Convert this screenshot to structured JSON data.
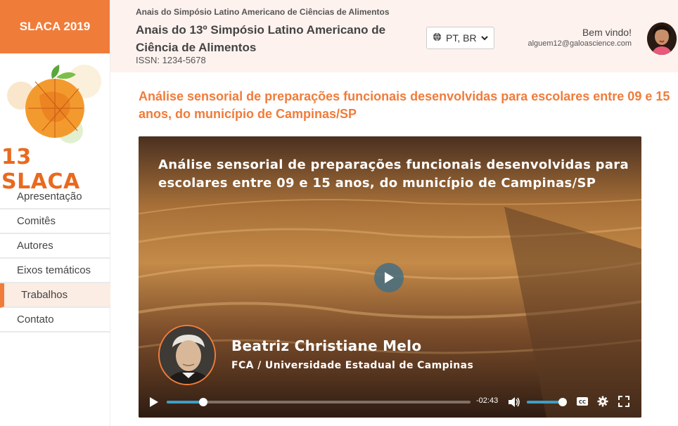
{
  "sidebar": {
    "brand": "SLACA 2019",
    "logo_text": "13 SLACA",
    "items": [
      {
        "label": "Apresentação",
        "active": false
      },
      {
        "label": "Comitês",
        "active": false
      },
      {
        "label": "Autores",
        "active": false
      },
      {
        "label": "Eixos temáticos",
        "active": false
      },
      {
        "label": "Trabalhos",
        "active": true
      },
      {
        "label": "Contato",
        "active": false
      }
    ]
  },
  "header": {
    "small_title": "Anais do Simpósio Latino Americano de Ciências de Alimentos",
    "title": "Anais do 13º Simpósio Latino Americano de Ciência de Alimentos",
    "issn": "ISSN: 1234-5678",
    "language": "PT, BR",
    "welcome": "Bem vindo!",
    "email": "alguem12@galoascience.com"
  },
  "main": {
    "article_title": "Análise sensorial de preparações funcionais desenvolvidas para escolares entre 09 e 15 anos, do município de Campinas/SP"
  },
  "video": {
    "title": "Análise sensorial de preparações funcionais desenvolvidas para escolares entre 09 e 15 anos, do município de Campinas/SP",
    "speaker_name": "Beatriz Christiane Melo",
    "speaker_affiliation": "FCA / Universidade Estadual de Campinas",
    "time_remaining": "-02:43",
    "progress_fraction": 0.12,
    "volume_fraction": 0.95
  },
  "colors": {
    "accent": "#f07c3a",
    "header_bg": "#fdf2ee",
    "player_accent": "#3aa0c8"
  },
  "icons": {
    "language": "globe-icon",
    "play": "play-icon",
    "volume": "volume-icon",
    "captions": "cc-icon",
    "settings": "gear-icon",
    "fullscreen": "fullscreen-icon"
  }
}
